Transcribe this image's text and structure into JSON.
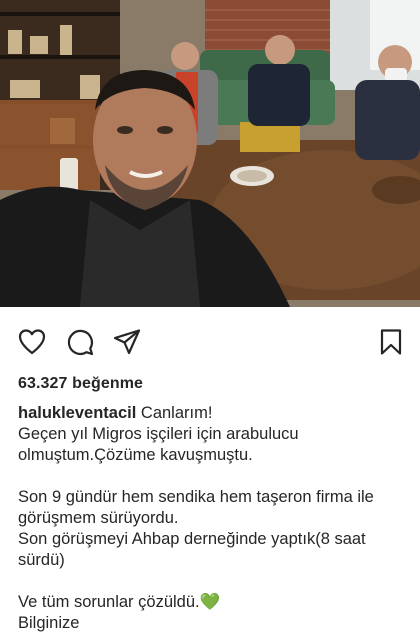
{
  "post": {
    "photo_alt": "photo",
    "likes_text": "63.327 beğenme",
    "username": "halukleventacil",
    "caption_first": " Canlarım!",
    "caption_rest": "Geçen yıl Migros işçileri için arabulucu\nolmuştum.Çözüme kavuşmuştu.\n\nSon 9 gündür hem sendika hem taşeron firma ile\ngörüşmem sürüyordu.\nSon görüşmeyi Ahbap derneğinde yaptık(8 saat\nsürdü)\n\nVe tüm sorunlar çözüldü.💚\nBilginize"
  },
  "actions": {
    "like_icon": "heart-outline",
    "comment_icon": "speech-bubble-outline",
    "share_icon": "paper-plane-outline",
    "save_icon": "bookmark-outline"
  },
  "colors": {
    "text": "#262626",
    "background": "#ffffff"
  }
}
